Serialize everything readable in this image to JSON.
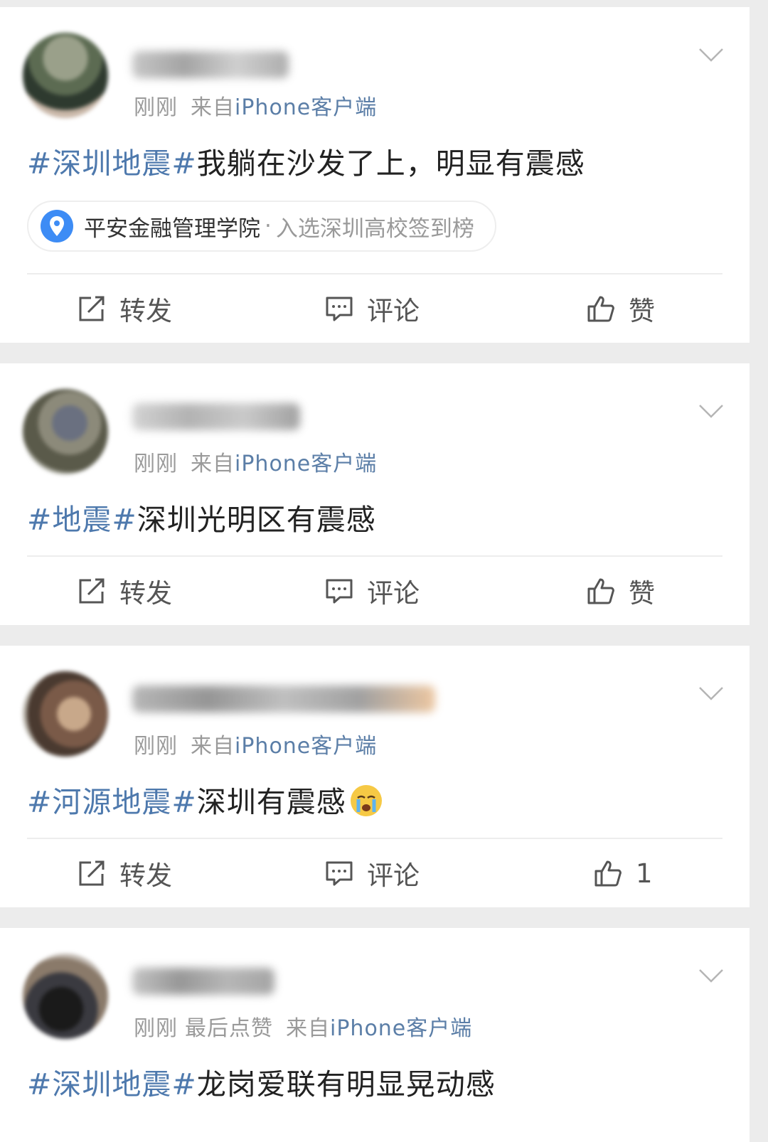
{
  "posts": [
    {
      "time": "刚刚",
      "source_prefix": "来自",
      "source": "iPhone客户端",
      "topic": "#深圳地震#",
      "text": "我躺在沙发了上，明显有震感",
      "location": {
        "place": "平安金融管理学院",
        "sep": "·",
        "rank": "入选深圳高校签到榜"
      },
      "actions": {
        "repost": "转发",
        "comment": "评论",
        "like": "赞"
      }
    },
    {
      "time": "刚刚",
      "source_prefix": "来自",
      "source": "iPhone客户端",
      "topic": "#地震#",
      "text": "深圳光明区有震感",
      "actions": {
        "repost": "转发",
        "comment": "评论",
        "like": "赞"
      }
    },
    {
      "time": "刚刚",
      "source_prefix": "来自",
      "source": "iPhone客户端",
      "topic": "#河源地震#",
      "text": "深圳有震感",
      "emoji": "crying-face-emoji",
      "actions": {
        "repost": "转发",
        "comment": "评论",
        "like": "1"
      }
    },
    {
      "time": "刚刚",
      "extra": "最后点赞",
      "source_prefix": "来自",
      "source": "iPhone客户端",
      "topic": "#深圳地震#",
      "text": "龙岗爱联有明显晃动感"
    }
  ],
  "colors": {
    "topic": "#4e79ad",
    "source": "#5b7ea7",
    "meta": "#9a9a9a",
    "background": "#ececec",
    "pin": "#3d8cf5"
  },
  "icons": [
    "chevron-down-icon",
    "location-pin-icon",
    "repost-icon",
    "comment-icon",
    "like-icon",
    "crying-face-emoji"
  ]
}
